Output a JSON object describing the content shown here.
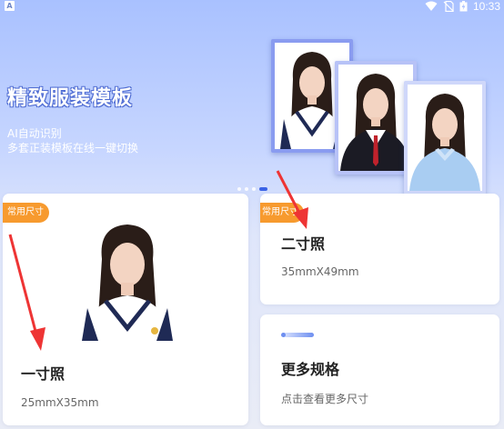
{
  "status_bar": {
    "app_icon_letter": "A",
    "time": "10:33"
  },
  "banner": {
    "title": "精致服装模板",
    "subtitle_line1": "AI自动识别",
    "subtitle_line2": "多套正装模板在线一键切换",
    "carousel": {
      "count": 4,
      "active_index": 3
    }
  },
  "cards": [
    {
      "badge": "常用尺寸",
      "title": "一寸照",
      "size": "25mmX35mm"
    },
    {
      "badge": "常用尺寸",
      "title": "二寸照",
      "size": "35mmX49mm"
    },
    {
      "title": "更多规格",
      "subtitle": "点击查看更多尺寸"
    }
  ],
  "colors": {
    "accent": "#3b63e6",
    "badge": "#f79a2e",
    "annotation_arrow": "#ee3434"
  }
}
